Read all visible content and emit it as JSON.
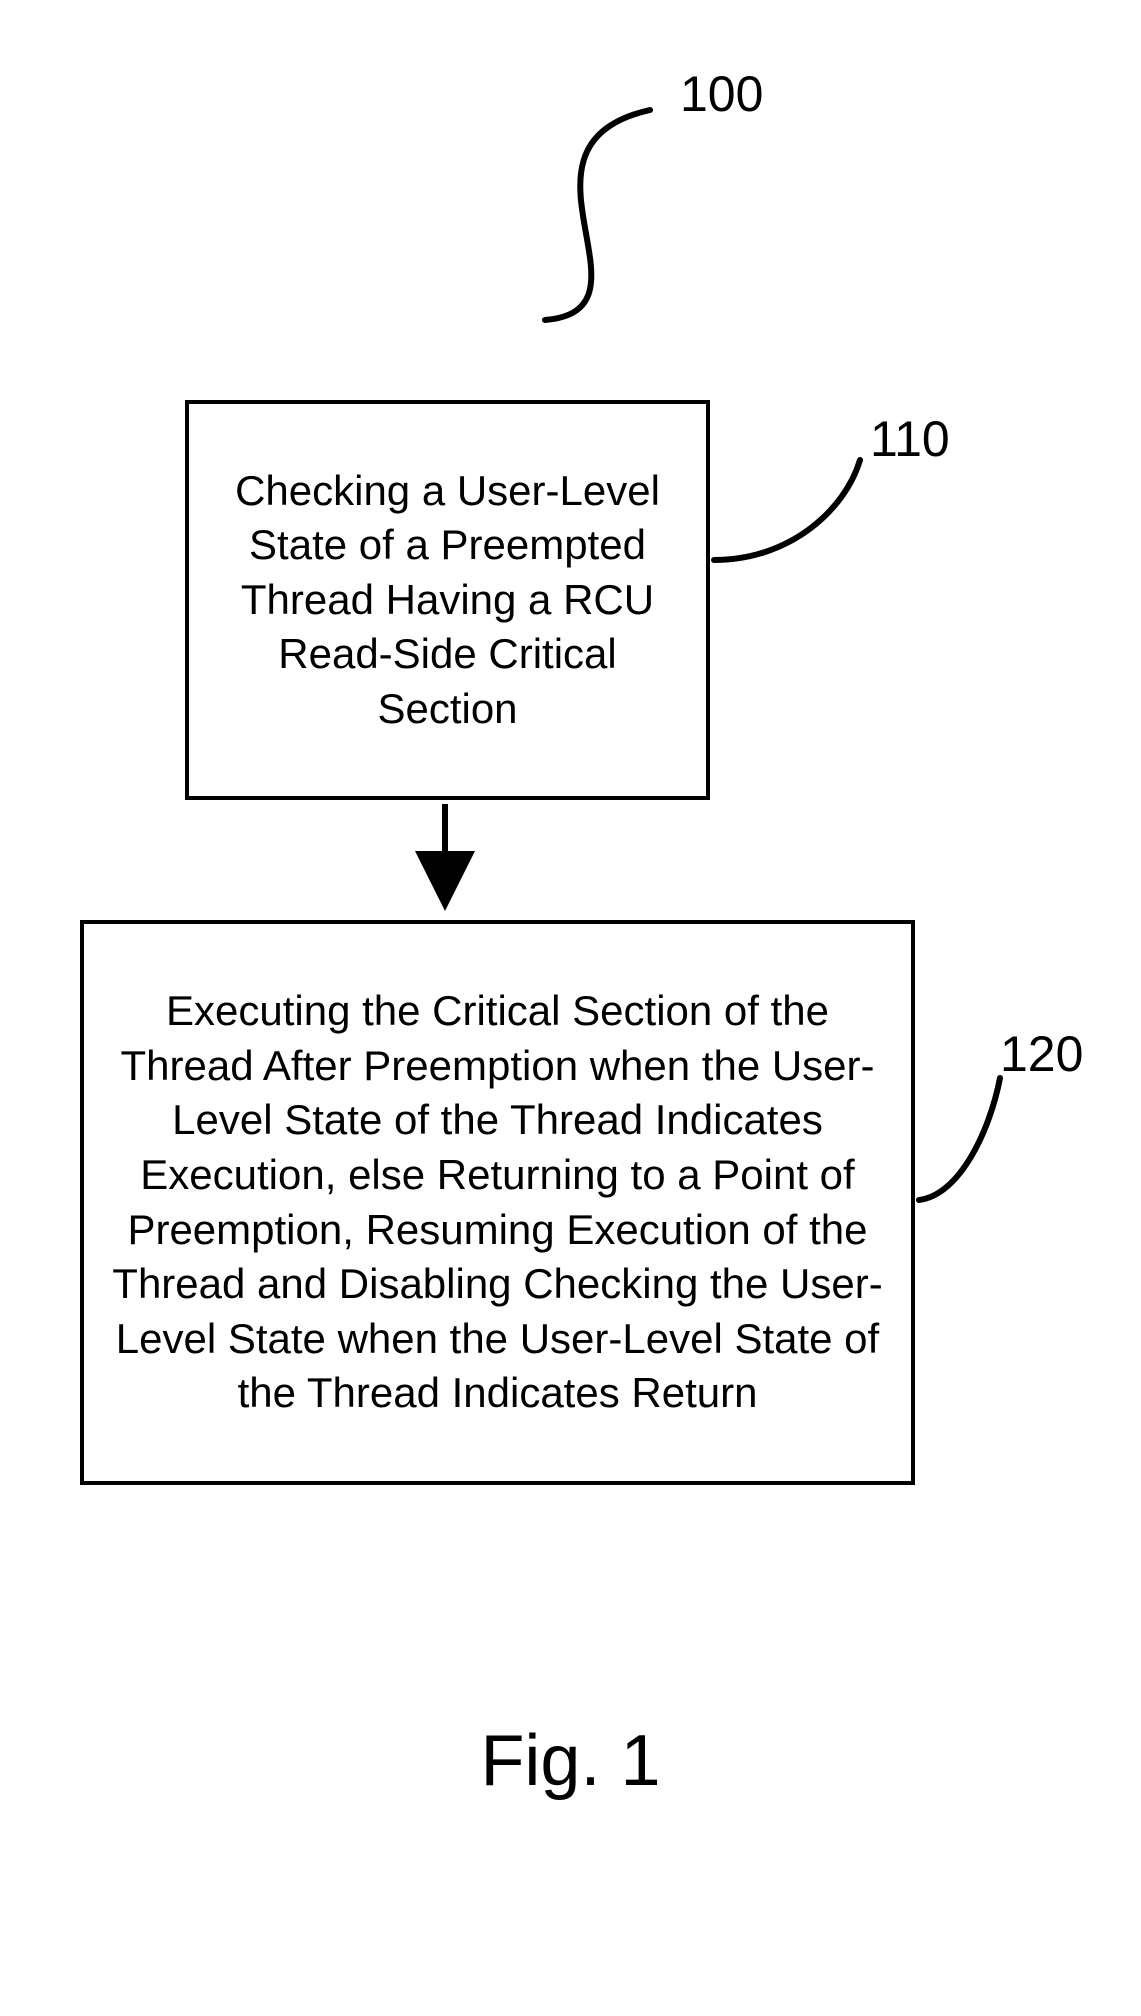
{
  "labels": {
    "fig_number": "100",
    "box1_number": "110",
    "box2_number": "120",
    "caption": "Fig. 1"
  },
  "boxes": {
    "box1_text": "Checking a User-Level State of a Preempted Thread Having a RCU Read-Side Critical Section",
    "box2_text": "Executing the Critical Section of the Thread After Preemption when the User-Level State of the Thread Indicates Execution, else Returning to a Point of Preemption, Resuming Execution of the Thread and Disabling Checking the User-Level State when the User-Level State of the Thread Indicates Return"
  }
}
